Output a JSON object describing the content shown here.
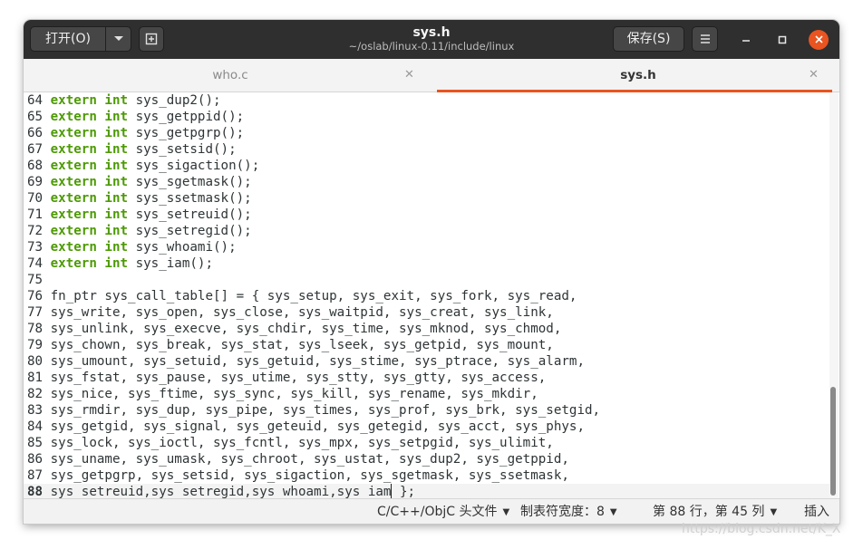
{
  "window": {
    "title": "sys.h",
    "subtitle": "~/oslab/linux-0.11/include/linux",
    "open_label": "打开(O)",
    "save_label": "保存(S)"
  },
  "tabs": [
    {
      "label": "who.c",
      "active": false
    },
    {
      "label": "sys.h",
      "active": true
    }
  ],
  "code": {
    "lines": [
      {
        "n": "64",
        "kw1": "extern",
        "kw2": "int",
        "text": "sys_dup2();"
      },
      {
        "n": "65",
        "kw1": "extern",
        "kw2": "int",
        "text": "sys_getppid();"
      },
      {
        "n": "66",
        "kw1": "extern",
        "kw2": "int",
        "text": "sys_getpgrp();"
      },
      {
        "n": "67",
        "kw1": "extern",
        "kw2": "int",
        "text": "sys_setsid();"
      },
      {
        "n": "68",
        "kw1": "extern",
        "kw2": "int",
        "text": "sys_sigaction();"
      },
      {
        "n": "69",
        "kw1": "extern",
        "kw2": "int",
        "text": "sys_sgetmask();"
      },
      {
        "n": "70",
        "kw1": "extern",
        "kw2": "int",
        "text": "sys_ssetmask();"
      },
      {
        "n": "71",
        "kw1": "extern",
        "kw2": "int",
        "text": "sys_setreuid();"
      },
      {
        "n": "72",
        "kw1": "extern",
        "kw2": "int",
        "text": "sys_setregid();"
      },
      {
        "n": "73",
        "kw1": "extern",
        "kw2": "int",
        "text": "sys_whoami();"
      },
      {
        "n": "74",
        "kw1": "extern",
        "kw2": "int",
        "text": "sys_iam();"
      },
      {
        "n": "75",
        "text": ""
      },
      {
        "n": "76",
        "text": "fn_ptr sys_call_table[] = { sys_setup, sys_exit, sys_fork, sys_read,"
      },
      {
        "n": "77",
        "text": "sys_write, sys_open, sys_close, sys_waitpid, sys_creat, sys_link,"
      },
      {
        "n": "78",
        "text": "sys_unlink, sys_execve, sys_chdir, sys_time, sys_mknod, sys_chmod,"
      },
      {
        "n": "79",
        "text": "sys_chown, sys_break, sys_stat, sys_lseek, sys_getpid, sys_mount,"
      },
      {
        "n": "80",
        "text": "sys_umount, sys_setuid, sys_getuid, sys_stime, sys_ptrace, sys_alarm,"
      },
      {
        "n": "81",
        "text": "sys_fstat, sys_pause, sys_utime, sys_stty, sys_gtty, sys_access,"
      },
      {
        "n": "82",
        "text": "sys_nice, sys_ftime, sys_sync, sys_kill, sys_rename, sys_mkdir,"
      },
      {
        "n": "83",
        "text": "sys_rmdir, sys_dup, sys_pipe, sys_times, sys_prof, sys_brk, sys_setgid,"
      },
      {
        "n": "84",
        "text": "sys_getgid, sys_signal, sys_geteuid, sys_getegid, sys_acct, sys_phys,"
      },
      {
        "n": "85",
        "text": "sys_lock, sys_ioctl, sys_fcntl, sys_mpx, sys_setpgid, sys_ulimit,"
      },
      {
        "n": "86",
        "text": "sys_uname, sys_umask, sys_chroot, sys_ustat, sys_dup2, sys_getppid,"
      },
      {
        "n": "87",
        "text": "sys_getpgrp, sys_setsid, sys_sigaction, sys_sgetmask, sys_ssetmask,"
      },
      {
        "n": "88",
        "text": "sys_setreuid,sys_setregid,sys_whoami,sys_iam",
        "after": " };",
        "current": true
      }
    ]
  },
  "status": {
    "language": "C/C++/ObjC 头文件",
    "tab_width": "制表符宽度：8",
    "position": "第 88 行，第 45 列",
    "mode": "插入"
  },
  "watermark": "https://blog.csdn.net/K_X",
  "colors": {
    "accent": "#e95420",
    "keyword": "#4e9a06",
    "titlebar": "#2f2f2f"
  },
  "icons": {
    "dropdown": "chevron-down-icon",
    "new_tab": "new-tab-icon",
    "menu": "hamburger-menu-icon",
    "minimize": "minimize-icon",
    "maximize": "maximize-icon",
    "close": "close-icon"
  }
}
